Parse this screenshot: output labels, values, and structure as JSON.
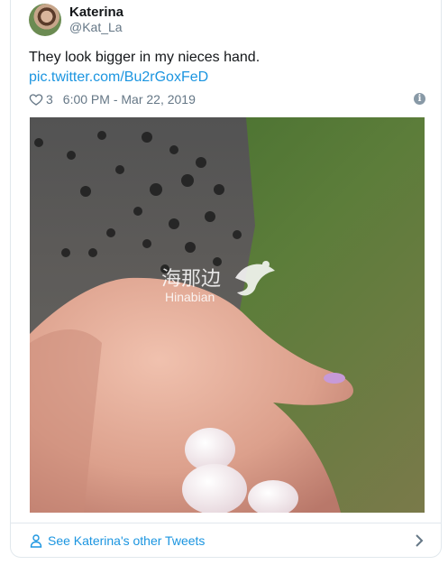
{
  "tweet": {
    "display_name": "Katerina",
    "handle": "@Kat_La",
    "text": "They look bigger in my nieces hand.",
    "link": "pic.twitter.com/Bu2rGoxFeD",
    "like_count": "3",
    "timestamp": "6:00 PM - Mar 22, 2019",
    "info_icon": "i"
  },
  "photo": {
    "watermark_cn": "海那边",
    "watermark_en": "Hinabian"
  },
  "footer": {
    "label": "See Katerina's other Tweets"
  },
  "colors": {
    "link": "#1b95e0",
    "secondary_text": "#657786",
    "border": "#e1e8ed"
  },
  "icons": [
    "avatar",
    "heart-icon",
    "info-icon",
    "person-icon",
    "chevron-right-icon"
  ]
}
